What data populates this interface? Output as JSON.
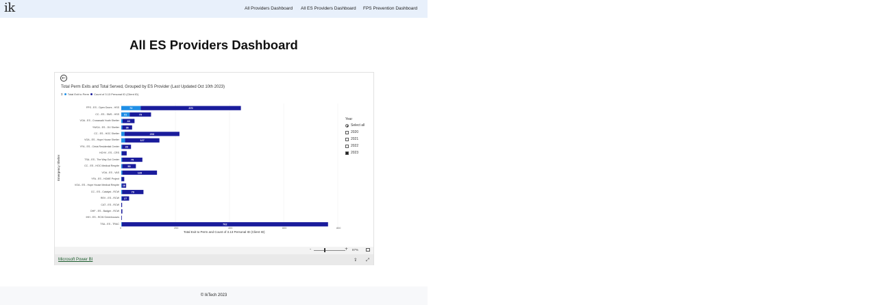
{
  "header": {
    "logo": "ik",
    "nav": [
      "All Providers Dashboard",
      "All ES Providers Dashboard",
      "FPS Prevention Dashboard"
    ]
  },
  "page_title": "All ES Providers Dashboard",
  "report": {
    "chart_title": "Total Perm Exits and Total Served, Grouped by ES Provider (Last Updated Oct 10th 2023)",
    "legend": {
      "icon": "sigma-icon",
      "items": [
        "Total Exit to Perm",
        "Count of 3.13 Personal ID (Client ID)"
      ]
    },
    "slicer": {
      "title": "Year",
      "options": [
        {
          "label": "Select all",
          "state": "radio"
        },
        {
          "label": "2020",
          "state": "unchecked"
        },
        {
          "label": "2021",
          "state": "unchecked"
        },
        {
          "label": "2022",
          "state": "unchecked"
        },
        {
          "label": "2023",
          "state": "checked"
        }
      ]
    },
    "zoom": {
      "minus": "-",
      "plus": "+",
      "percent": "87%"
    },
    "powerbi_link": "Microsoft Power BI"
  },
  "chart_data": {
    "type": "bar",
    "orientation": "horizontal",
    "stacked": true,
    "title": "Total Perm Exits and Total Served, Grouped by ES Provider (Last Updated Oct 10th 2023)",
    "xlabel": "Total Exit to Perm and Count of 3.13 Personal ID (Client ID)",
    "ylabel": "Emergency Shelter",
    "xlim": [
      0,
      800
    ],
    "xticks": [
      0,
      200,
      400,
      600,
      800
    ],
    "colors": {
      "Total Exit to Perm": "#1f8fe6",
      "Count of 3.13 Personal ID (Client ID)": "#1a1c9c"
    },
    "categories": [
      "FPS - ES - Open Doors - HSS",
      "CC - ES - SMS - HSS",
      "VOA - ES - Crosswalk Youth Shelter",
      "YWCA - ES - DV Shelter",
      "CC - ES - HOC Shelter",
      "VOA - ES - Hope House Shelter",
      "YFA - ES - Crisis Residential Center",
      "HCHV - ES - CRS",
      "TSA - ES - The Way Out Center",
      "CC - ES - HOC Medical Respite",
      "VOA - ES - VAS",
      "YFA - ES - HOME Project",
      "VOA - ES - Hope House Medical Respite",
      "CC - ES - Catalyst - RCW",
      "REV - ES - RCW",
      "CAT - ES - RCW",
      "DHF - ES - Badger - RCW",
      "IHH - ES - RCW Greenhouses",
      "TSA - ES - TRAC"
    ],
    "series": [
      {
        "name": "Total Exit to Perm",
        "values": [
          72,
          31,
          5,
          4,
          12,
          14,
          3,
          2,
          3,
          4,
          4,
          1,
          2,
          3,
          2,
          0,
          0,
          0,
          2
        ]
      },
      {
        "name": "Count of 3.13 Personal ID (Client ID)",
        "values": [
          370,
          79,
          44,
          36,
          203,
          127,
          33,
          18,
          75,
          50,
          128,
          10,
          16,
          79,
          27,
          3,
          4,
          2,
          762
        ]
      }
    ],
    "data_labels": [
      [
        72,
        370
      ],
      [
        31,
        79
      ],
      [
        null,
        44
      ],
      [
        null,
        36
      ],
      [
        null,
        203
      ],
      [
        null,
        127
      ],
      [
        null,
        33
      ],
      [
        null,
        null
      ],
      [
        null,
        75
      ],
      [
        null,
        50
      ],
      [
        null,
        128
      ],
      [
        null,
        null
      ],
      [
        null,
        16
      ],
      [
        null,
        79
      ],
      [
        null,
        27
      ],
      [
        null,
        null
      ],
      [
        null,
        null
      ],
      [
        null,
        null
      ],
      [
        null,
        762
      ]
    ],
    "grid": true,
    "legend_position": "top-left"
  },
  "footer": "© IkTech 2023"
}
